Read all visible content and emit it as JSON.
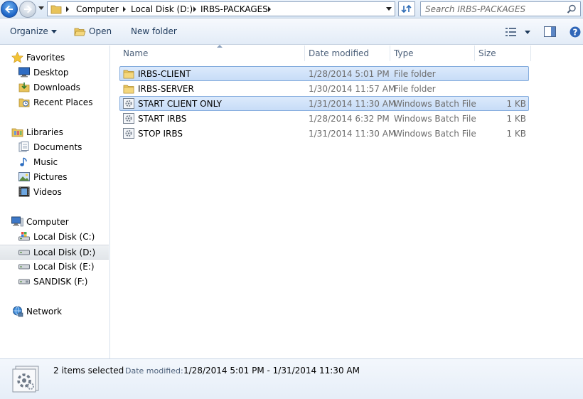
{
  "address": {
    "breadcrumbs": [
      "Computer",
      "Local Disk (D:)",
      "IRBS-PACKAGES"
    ],
    "search_placeholder": "Search IRBS-PACKAGES"
  },
  "toolbar": {
    "organize_label": "Organize",
    "open_label": "Open",
    "new_folder_label": "New folder"
  },
  "nav": {
    "favorites": {
      "label": "Favorites",
      "items": [
        {
          "label": "Desktop",
          "icon": "desktop-icon"
        },
        {
          "label": "Downloads",
          "icon": "downloads-icon"
        },
        {
          "label": "Recent Places",
          "icon": "recent-places-icon"
        }
      ]
    },
    "libraries": {
      "label": "Libraries",
      "items": [
        {
          "label": "Documents",
          "icon": "documents-icon"
        },
        {
          "label": "Music",
          "icon": "music-icon"
        },
        {
          "label": "Pictures",
          "icon": "pictures-icon"
        },
        {
          "label": "Videos",
          "icon": "videos-icon"
        }
      ]
    },
    "computer": {
      "label": "Computer",
      "items": [
        {
          "label": "Local Disk (C:)",
          "icon": "system-drive-icon"
        },
        {
          "label": "Local Disk (D:)",
          "icon": "drive-icon",
          "selected": true
        },
        {
          "label": "Local Disk (E:)",
          "icon": "drive-icon"
        },
        {
          "label": "SANDISK (F:)",
          "icon": "usb-drive-icon"
        }
      ]
    },
    "network": {
      "label": "Network",
      "icon": "network-icon"
    }
  },
  "columns": {
    "name": "Name",
    "date": "Date modified",
    "type": "Type",
    "size": "Size"
  },
  "files": [
    {
      "name": "IRBS-CLIENT",
      "date": "1/28/2014 5:01 PM",
      "type": "File folder",
      "size": "",
      "icon": "folder-icon",
      "selected": true
    },
    {
      "name": "IRBS-SERVER",
      "date": "1/30/2014 11:57 AM",
      "type": "File folder",
      "size": "",
      "icon": "folder-icon",
      "selected": false
    },
    {
      "name": "START CLIENT ONLY",
      "date": "1/31/2014 11:30 AM",
      "type": "Windows Batch File",
      "size": "1 KB",
      "icon": "batch-file-icon",
      "selected": true
    },
    {
      "name": "START IRBS",
      "date": "1/28/2014 6:32 PM",
      "type": "Windows Batch File",
      "size": "1 KB",
      "icon": "batch-file-icon",
      "selected": false
    },
    {
      "name": "STOP IRBS",
      "date": "1/31/2014 11:30 AM",
      "type": "Windows Batch File",
      "size": "1 KB",
      "icon": "batch-file-icon",
      "selected": false
    }
  ],
  "details": {
    "count": "2 items selected",
    "date_label": "Date modified:",
    "date_value": "1/28/2014 5:01 PM - 1/31/2014 11:30 AM"
  },
  "colors": {
    "selection": "#cce0f8",
    "selection_border": "#84acdd",
    "folder": "#e8c35a"
  }
}
